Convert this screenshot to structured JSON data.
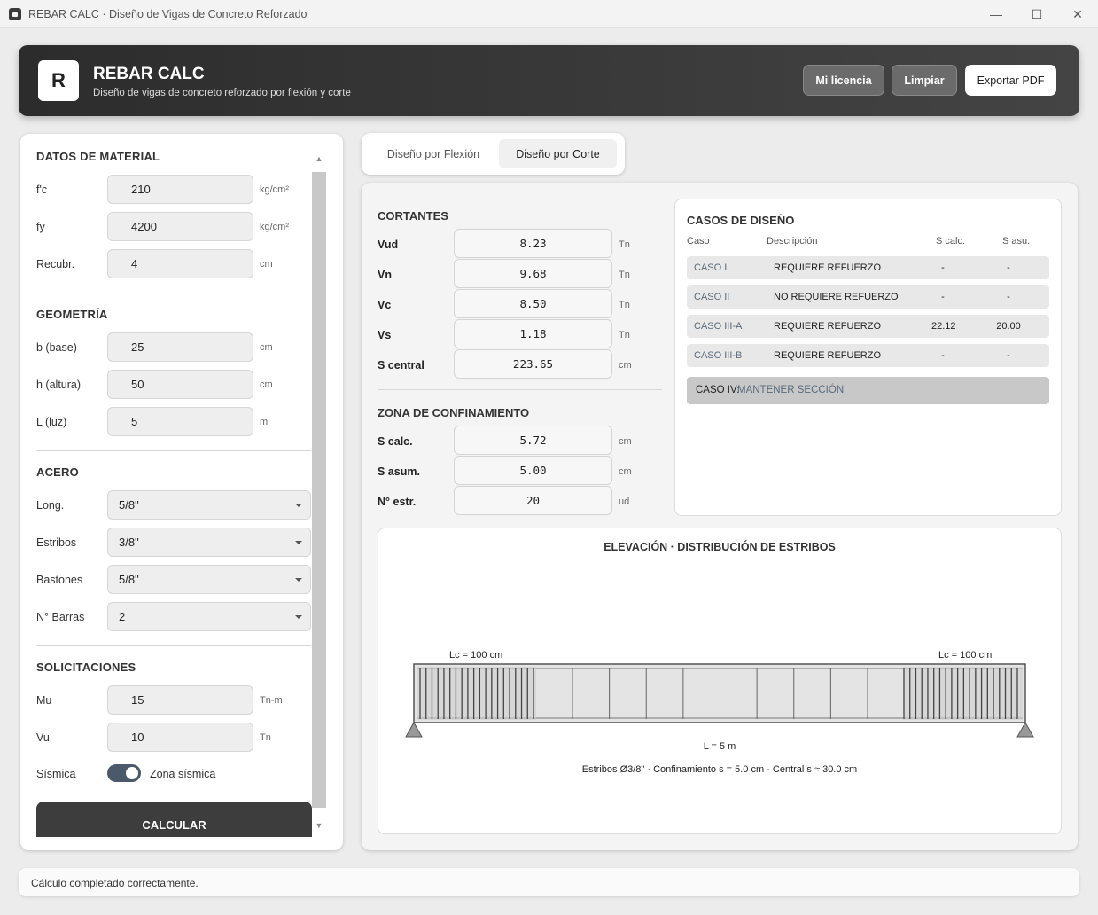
{
  "window": {
    "title": "REBAR CALC · Diseño de Vigas de Concreto Reforzado"
  },
  "header": {
    "logo_letter": "R",
    "title": "REBAR CALC",
    "subtitle": "Diseño de vigas de concreto reforzado por flexión y corte",
    "buttons": {
      "license": "Mi licencia",
      "clear": "Limpiar",
      "export": "Exportar PDF"
    }
  },
  "material": {
    "title": "DATOS DE MATERIAL",
    "fc": {
      "label": "f'c",
      "value": "210",
      "unit": "kg/cm²"
    },
    "fy": {
      "label": "fy",
      "value": "4200",
      "unit": "kg/cm²"
    },
    "cover": {
      "label": "Recubr.",
      "value": "4",
      "unit": "cm"
    }
  },
  "geometry": {
    "title": "GEOMETRÍA",
    "b": {
      "label": "b (base)",
      "value": "25",
      "unit": "cm"
    },
    "h": {
      "label": "h (altura)",
      "value": "50",
      "unit": "cm"
    },
    "L": {
      "label": "L (luz)",
      "value": "5",
      "unit": "m"
    }
  },
  "steel": {
    "title": "ACERO",
    "long": {
      "label": "Long.",
      "value": "5/8\""
    },
    "stirrups": {
      "label": "Estribos",
      "value": "3/8\""
    },
    "bastones": {
      "label": "Bastones",
      "value": "5/8\""
    },
    "bars": {
      "label": "N° Barras",
      "value": "2"
    }
  },
  "loads": {
    "title": "SOLICITACIONES",
    "mu": {
      "label": "Mu",
      "value": "15",
      "unit": "Tn-m"
    },
    "vu": {
      "label": "Vu",
      "value": "10",
      "unit": "Tn"
    },
    "seismic": {
      "label": "Sísmica",
      "text": "Zona sísmica",
      "on": true
    }
  },
  "calculate_label": "CALCULAR",
  "tabs": {
    "flexion": "Diseño por Flexión",
    "corte": "Diseño por Corte",
    "active": "corte"
  },
  "shear": {
    "title": "CORTANTES",
    "rows": [
      {
        "label": "Vud",
        "value": "8.23",
        "unit": "Tn"
      },
      {
        "label": "Vn",
        "value": "9.68",
        "unit": "Tn"
      },
      {
        "label": "Vc",
        "value": "8.50",
        "unit": "Tn"
      },
      {
        "label": "Vs",
        "value": "1.18",
        "unit": "Tn"
      },
      {
        "label": "S central",
        "value": "223.65",
        "unit": "cm"
      }
    ]
  },
  "confinement": {
    "title": "ZONA DE CONFINAMIENTO",
    "rows": [
      {
        "label": "S calc.",
        "value": "5.72",
        "unit": "cm"
      },
      {
        "label": "S asum.",
        "value": "5.00",
        "unit": "cm"
      },
      {
        "label": "N° estr.",
        "value": "20",
        "unit": "ud"
      }
    ]
  },
  "cases": {
    "title": "CASOS DE DISEÑO",
    "headers": {
      "case": "Caso",
      "desc": "Descripción",
      "scalc": "S calc.",
      "sasu": "S asu."
    },
    "rows": [
      {
        "name": "CASO I",
        "desc": "REQUIERE REFUERZO",
        "scalc": "-",
        "sasu": "-"
      },
      {
        "name": "CASO II",
        "desc": "NO REQUIERE REFUERZO",
        "scalc": "-",
        "sasu": "-"
      },
      {
        "name": "CASO III-A",
        "desc": "REQUIERE REFUERZO",
        "scalc": "22.12",
        "sasu": "20.00"
      },
      {
        "name": "CASO III-B",
        "desc": "REQUIERE REFUERZO",
        "scalc": "-",
        "sasu": "-"
      }
    ],
    "case_iv": {
      "label": "CASO IV:",
      "value": "MANTENER SECCIÓN"
    }
  },
  "diagram": {
    "title": "ELEVACIÓN · DISTRIBUCIÓN DE ESTRIBOS",
    "lc_left": "Lc = 100 cm",
    "lc_right": "Lc = 100 cm",
    "span": "L = 5 m",
    "caption": "Estribos Ø3/8\"  ·  Confinamiento s = 5.0 cm  ·  Central s ≈ 30.0 cm"
  },
  "status": "Cálculo completado correctamente.",
  "colors": {
    "header_dark": "#2c2c2c",
    "accent_slate": "#4a5a6a",
    "case_name": "#5a6a7a"
  },
  "icons": {
    "app": "app-icon",
    "minimize": "minimize-icon",
    "maximize": "maximize-icon",
    "close": "close-icon",
    "caret": "chevron-down-icon"
  }
}
